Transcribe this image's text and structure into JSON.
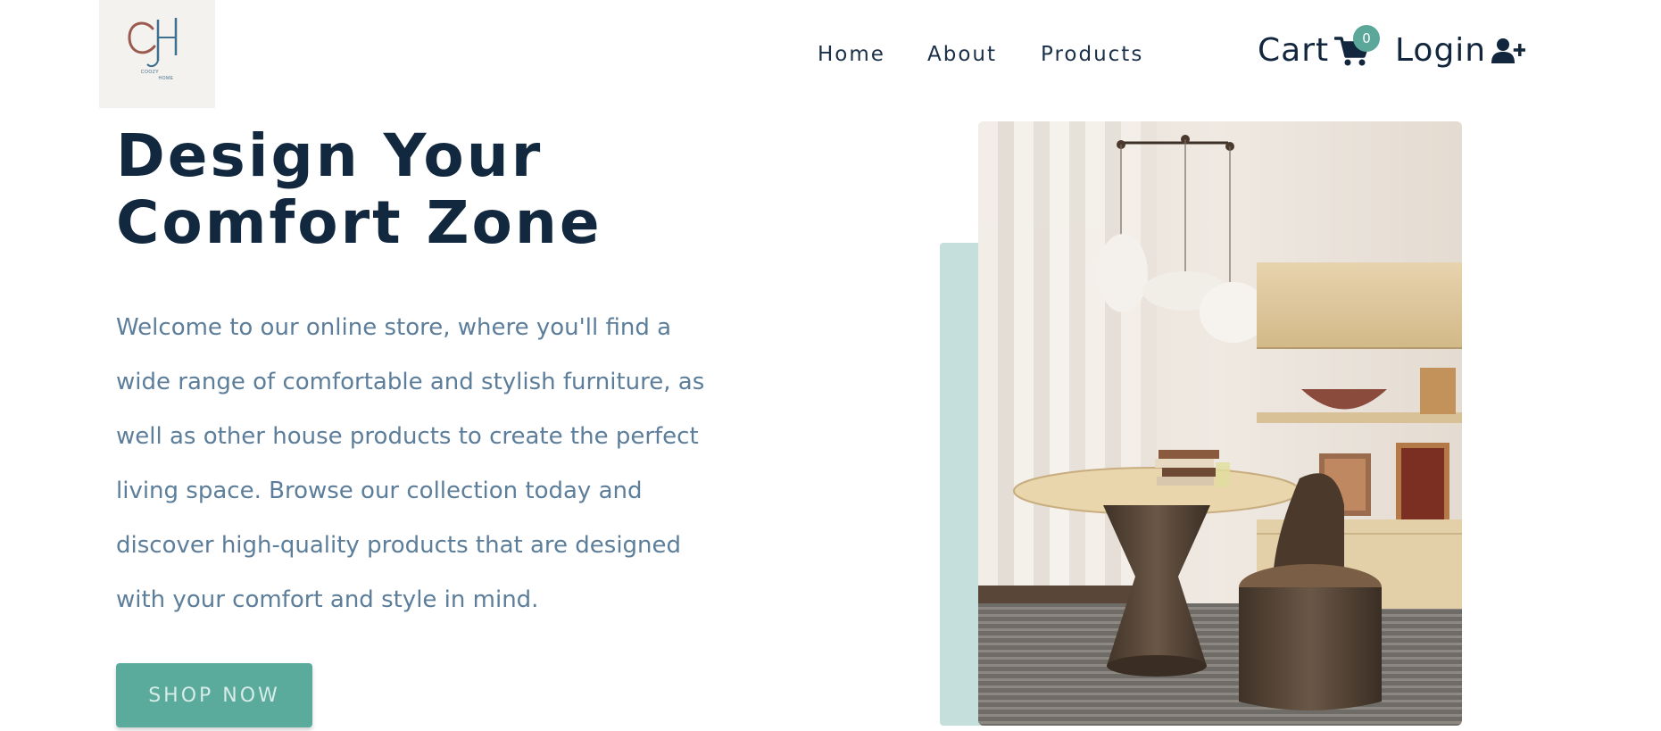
{
  "header": {
    "logo": {
      "monogram": "CH",
      "line1": "COOZY",
      "line2": "HOME",
      "icon": "monogram-logo"
    },
    "nav": [
      {
        "label": "Home"
      },
      {
        "label": "About"
      },
      {
        "label": "Products"
      }
    ],
    "cart": {
      "label": "Cart",
      "icon": "shopping-cart-icon",
      "count": "0"
    },
    "login": {
      "label": "Login",
      "icon": "user-plus-icon"
    }
  },
  "hero": {
    "title_line1": "Design Your",
    "title_line2": "Comfort Zone",
    "description": "Welcome to our online store, where you'll find a wide range of comfortable and stylish furniture, as well as other house products to create the perfect living space. Browse our collection today and discover high-quality products that are designed with your comfort and style in mind.",
    "cta_label": "SHOP NOW",
    "image_icon": "furniture-room-photo"
  },
  "colors": {
    "primary_text": "#12283f",
    "body_text": "#5c7e9a",
    "accent": "#5bab9d",
    "accent_light": "#c4dfdc",
    "logo_bg": "#f4f2ee"
  }
}
